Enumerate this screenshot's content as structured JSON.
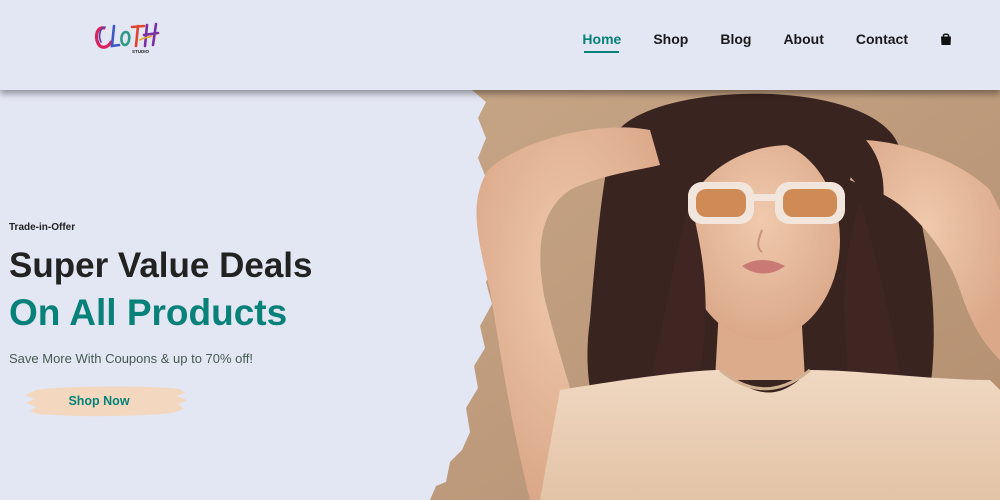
{
  "header": {
    "logo": {
      "brand": "Cloth",
      "tagline": "STUDIO"
    },
    "nav": [
      {
        "label": "Home",
        "active": true
      },
      {
        "label": "Shop",
        "active": false
      },
      {
        "label": "Blog",
        "active": false
      },
      {
        "label": "About",
        "active": false
      },
      {
        "label": "Contact",
        "active": false
      }
    ],
    "cart_icon": "shopping-bag-icon"
  },
  "hero": {
    "kicker": "Trade-in-Offer",
    "heading_line1": "Super Value Deals",
    "heading_line2": "On All Products",
    "subtext": "Save More With Coupons & up to 70% off!",
    "button_label": "Shop Now",
    "image": "woman-in-sunglasses-photo"
  },
  "colors": {
    "background": "#e3e6f3",
    "accent": "#088178",
    "button_brush": "#f3d8bf",
    "photo_backdrop": "#bf9c7c"
  }
}
